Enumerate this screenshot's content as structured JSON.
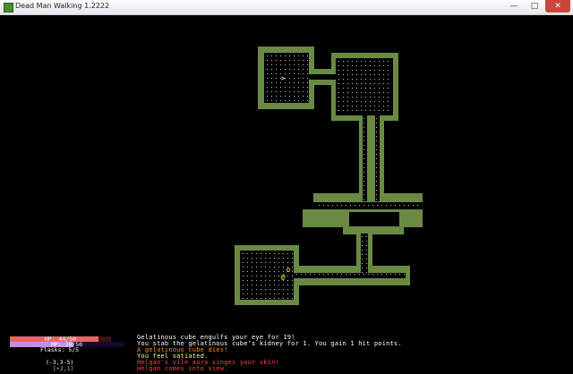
{
  "window": {
    "title": "Dead Man Walking 1.2222",
    "controls": {
      "minimize": "—",
      "maximize": "□",
      "close": "✕"
    }
  },
  "hud": {
    "hp": {
      "text": "HP: 44/50",
      "value": 44,
      "max": 50,
      "color": "#e86464"
    },
    "mp": {
      "text": "MP: 28/50",
      "value": 28,
      "max": 50,
      "color": "#c88ce6"
    },
    "flasks": "Flasks: 5/5",
    "coords": "(-3,3-5)",
    "sub_coords": "[+2,1]"
  },
  "messages": [
    {
      "text": "Gelatinous cube engulfs your eye for 19!",
      "color": "#ffffff"
    },
    {
      "text": "You stab the gelatinous cube's kidney for 1. You gain 1 hit points.",
      "color": "#ffffff"
    },
    {
      "text": "A gelatinous cube dies!",
      "color": "#ff8c00"
    },
    {
      "text": "You feel satiated.",
      "color": "#ffff66"
    },
    {
      "text": "Helgan's vile aura singes your skin!",
      "color": "#ff4040"
    },
    {
      "text": "Helgan comes into view.",
      "color": "#ff4040"
    }
  ],
  "map": {
    "wall_color": "#6a8a44",
    "floor_color": "#c8c8c8",
    "player": {
      "glyph": "@",
      "color": "#ffff00"
    },
    "monster": {
      "glyph": "o",
      "color": "#ffff66"
    },
    "stairs": {
      "glyph": ">",
      "color": "#ffffff"
    }
  }
}
